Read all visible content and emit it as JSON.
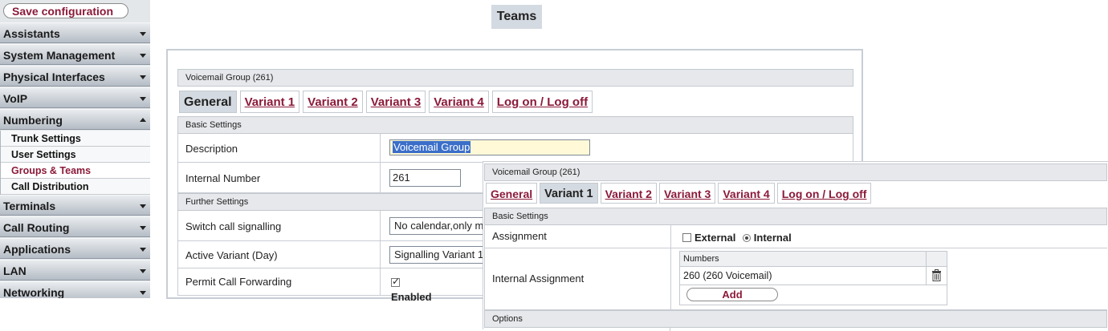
{
  "sidebar": {
    "save_label": "Save configuration",
    "items": [
      {
        "label": "Assistants"
      },
      {
        "label": "System Management"
      },
      {
        "label": "Physical Interfaces"
      },
      {
        "label": "VoIP"
      },
      {
        "label": "Numbering"
      },
      {
        "label": "Terminals"
      },
      {
        "label": "Call Routing"
      },
      {
        "label": "Applications"
      },
      {
        "label": "LAN"
      },
      {
        "label": "Networking"
      }
    ],
    "numbering_sub": [
      {
        "label": "Trunk Settings"
      },
      {
        "label": "User Settings"
      },
      {
        "label": "Groups & Teams"
      },
      {
        "label": "Call Distribution"
      }
    ]
  },
  "page_title": "Teams",
  "panel1": {
    "group_title": "Voicemail Group (261)",
    "tabs": [
      {
        "label": "General"
      },
      {
        "label": "Variant 1"
      },
      {
        "label": "Variant 2"
      },
      {
        "label": "Variant 3"
      },
      {
        "label": "Variant 4"
      },
      {
        "label": "Log on / Log off"
      }
    ],
    "basic_settings": "Basic Settings",
    "description_label": "Description",
    "description_value": "Voicemail Group",
    "internal_number_label": "Internal Number",
    "internal_number_value": "261",
    "further_settings": "Further Settings",
    "switch_call_label": "Switch call signalling",
    "switch_call_value": "No calendar,only m",
    "active_variant_label": "Active Variant (Day)",
    "active_variant_value": "Signalling Variant 1",
    "permit_forwarding_label": "Permit Call Forwarding",
    "permit_forwarding_value": "Enabled"
  },
  "panel2": {
    "group_title": "Voicemail Group (261)",
    "tabs": [
      {
        "label": "General"
      },
      {
        "label": "Variant 1"
      },
      {
        "label": "Variant 2"
      },
      {
        "label": "Variant 3"
      },
      {
        "label": "Variant 4"
      },
      {
        "label": "Log on / Log off"
      }
    ],
    "basic_settings": "Basic Settings",
    "assignment_label": "Assignment",
    "external_label": "External",
    "internal_label": "Internal",
    "internal_assignment_label": "Internal Assignment",
    "numbers_header": "Numbers",
    "numbers": [
      "260 (260 Voicemail)"
    ],
    "add_label": "Add",
    "options_label": "Options"
  },
  "colors": {
    "accent": "#8b1a3a",
    "sidebar_bg": "#e4e7ea",
    "tab_active": "#d4dae1"
  }
}
